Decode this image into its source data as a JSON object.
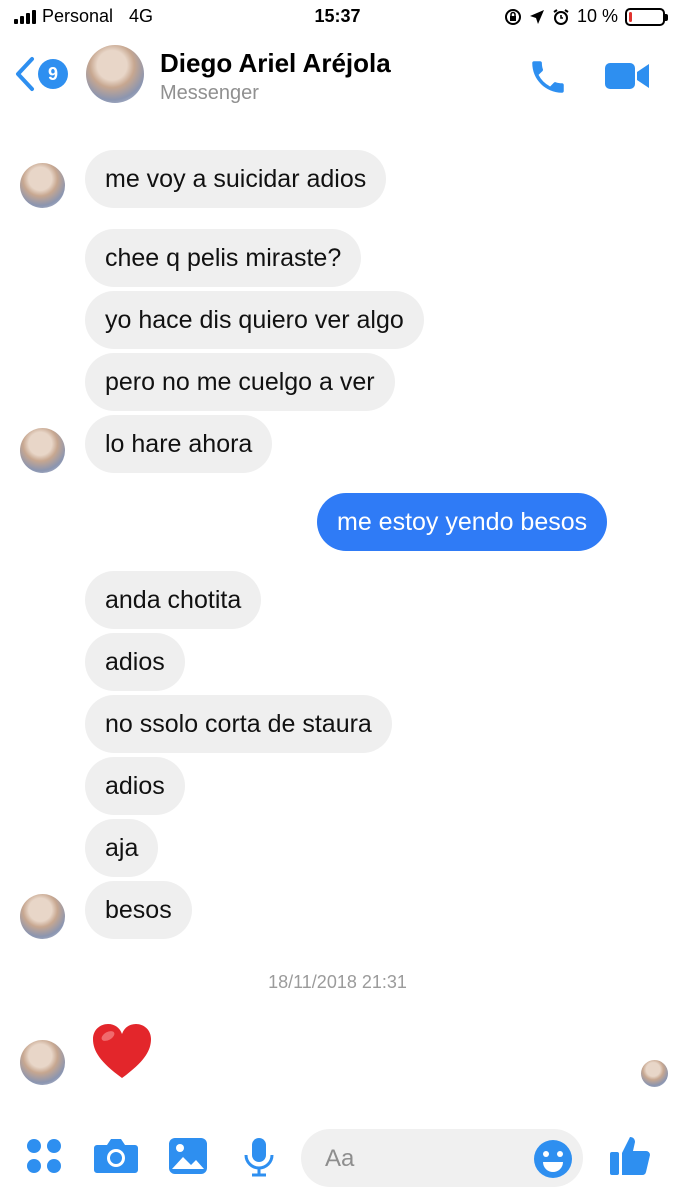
{
  "status_bar": {
    "carrier": "Personal",
    "network": "4G",
    "time": "15:37",
    "battery": "10 %",
    "battery_level": 0.1,
    "battery_color": "#e0332e"
  },
  "header": {
    "back_badge_count": "9",
    "contact_name": "Diego Ariel Aréjola",
    "subtitle": "Messenger",
    "accent": "#2e8ff0"
  },
  "messages": [
    {
      "from": "them",
      "text": "me voy a suicidar adios"
    },
    {
      "from": "them",
      "text": "chee q pelis miraste?"
    },
    {
      "from": "them",
      "text": "yo hace dis quiero ver algo"
    },
    {
      "from": "them",
      "text": "pero no me cuelgo a ver"
    },
    {
      "from": "them",
      "text": "lo hare ahora"
    },
    {
      "from": "me",
      "text": "me estoy yendo besos"
    },
    {
      "from": "them",
      "text": "anda chotita"
    },
    {
      "from": "them",
      "text": "adios"
    },
    {
      "from": "them",
      "text": "no ssolo corta de staura"
    },
    {
      "from": "them",
      "text": "adios"
    },
    {
      "from": "them",
      "text": "aja"
    },
    {
      "from": "them",
      "text": "besos"
    }
  ],
  "timestamp": "18/11/2018 21:31",
  "last_message": {
    "from": "them",
    "emoji": "heart"
  },
  "composer": {
    "placeholder": "Aa",
    "icons": [
      "more-icon",
      "camera-icon",
      "gallery-icon",
      "microphone-icon",
      "emoji-icon",
      "thumbs-up-icon"
    ]
  },
  "colors": {
    "incoming_bubble": "#efefef",
    "outgoing_bubble": "#2f7bf6"
  }
}
